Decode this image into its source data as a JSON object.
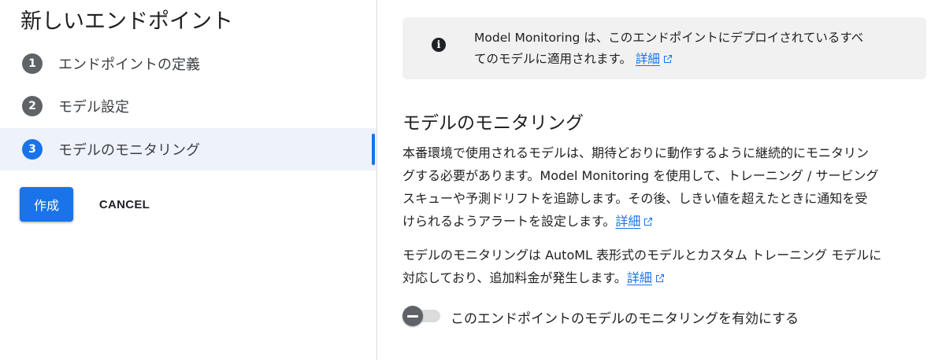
{
  "panel_title": "新しいエンドポイント",
  "steps": [
    {
      "number": "1",
      "label": "エンドポイントの定義"
    },
    {
      "number": "2",
      "label": "モデル設定"
    },
    {
      "number": "3",
      "label": "モデルのモニタリング"
    }
  ],
  "actions": {
    "create_label": "作成",
    "cancel_label": "CANCEL"
  },
  "info_box": {
    "icon": "info-icon",
    "line1": "Model Monitoring は、このエンドポイントにデプロイされているすべ",
    "line2_prefix": "てのモデルに適用されます。",
    "link": "詳細"
  },
  "section": {
    "title": "モデルのモニタリング",
    "para1_lines": [
      "本番環境で使用されるモデルは、期待どおりに動作するように継続的にモニタリン",
      "グする必要があります。Model Monitoring を使用して、トレーニング / サービング",
      "スキューや予測ドリフトを追跡します。その後、しきい値を超えたときに通知を受",
      "けられるようアラートを設定します。"
    ],
    "para1_link": "詳細",
    "para2_lines": [
      "モデルのモニタリングは AutoML 表形式のモデルとカスタム トレーニング モデルに",
      "対応しており、追加料金が発生します。"
    ],
    "para2_link": "詳細"
  },
  "toggle": {
    "label": "このエンドポイントのモデルのモニタリングを有効にする",
    "enabled": false
  },
  "colors": {
    "accent": "#1a73e8",
    "info_bg": "#f1f1f1",
    "active_step_bg": "#eef3fb"
  }
}
